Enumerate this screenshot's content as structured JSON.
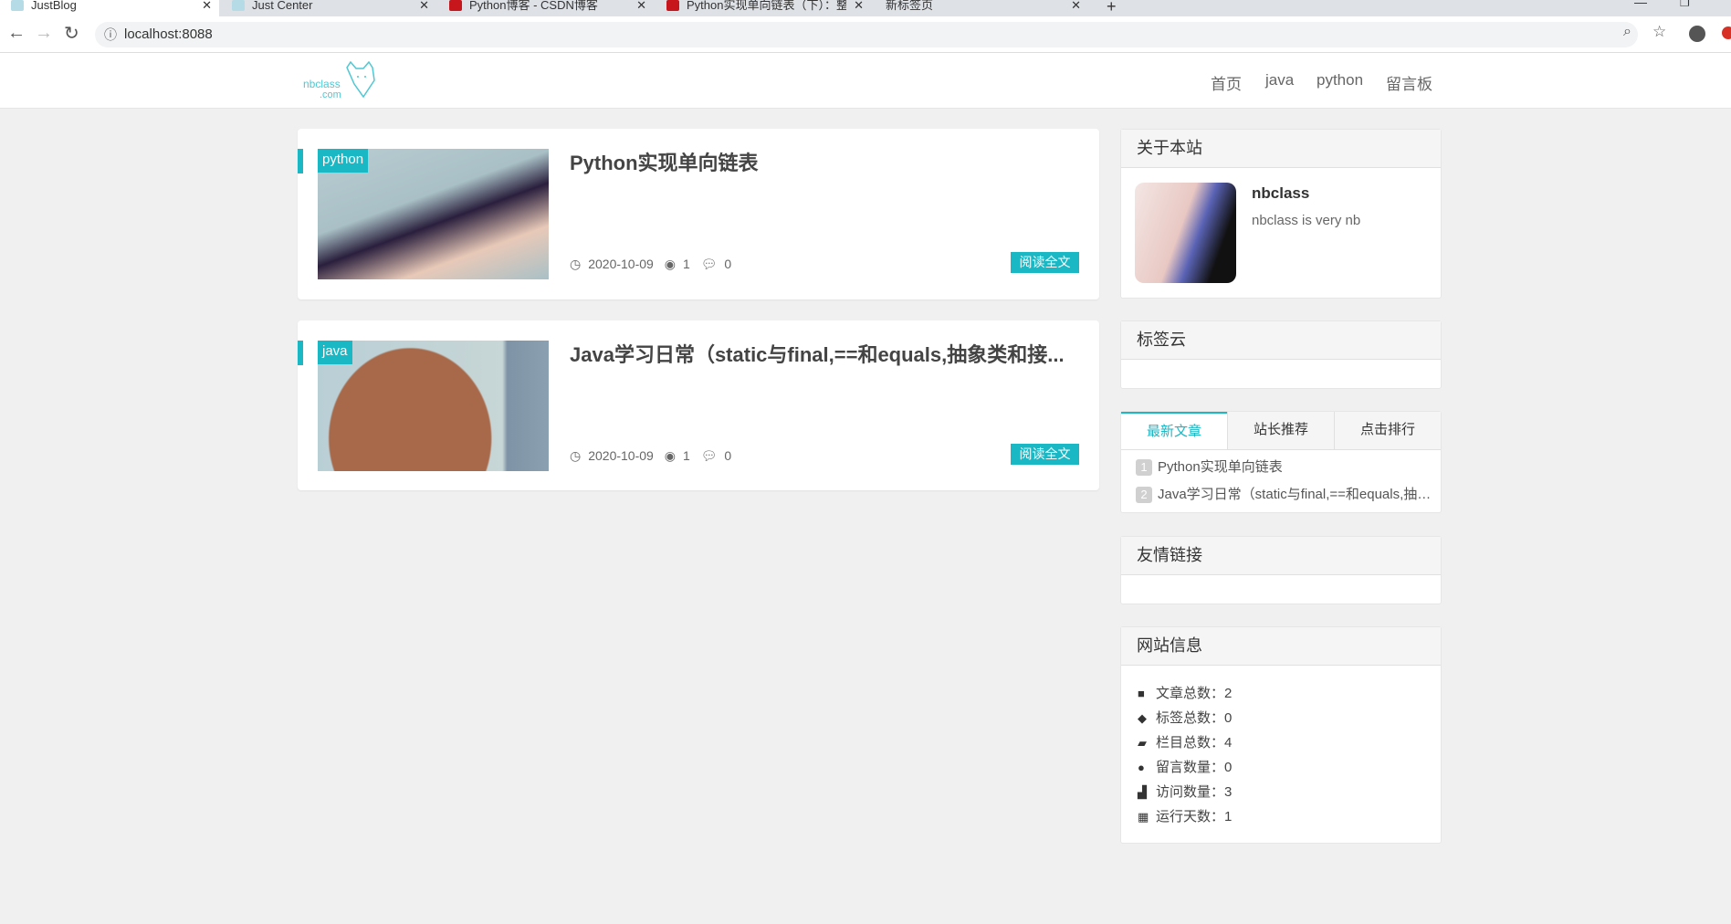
{
  "browser": {
    "tabs": [
      {
        "title": "JustBlog"
      },
      {
        "title": "Just Center"
      },
      {
        "title": "Python博客 - CSDN博客"
      },
      {
        "title": "Python实现单向链表（下）：整"
      },
      {
        "title": "新标签页"
      }
    ],
    "url": "localhost:8088"
  },
  "header": {
    "logo_text": "nbclass.com",
    "nav": [
      "首页",
      "java",
      "python",
      "留言板"
    ]
  },
  "posts": [
    {
      "category": "python",
      "title": "Python实现单向链表",
      "date": "2020-10-09",
      "views": "1",
      "comments": "0",
      "read_more": "阅读全文"
    },
    {
      "category": "java",
      "title": "Java学习日常（static与final,==和equals,抽象类和接...",
      "date": "2020-10-09",
      "views": "1",
      "comments": "0",
      "read_more": "阅读全文"
    }
  ],
  "sidebar": {
    "about": {
      "title": "关于本站",
      "name": "nbclass",
      "desc": "nbclass is very nb"
    },
    "tag_cloud": {
      "title": "标签云"
    },
    "tabs": {
      "labels": [
        "最新文章",
        "站长推荐",
        "点击排行"
      ],
      "items": [
        {
          "n": "1",
          "title": "Python实现单向链表"
        },
        {
          "n": "2",
          "title": "Java学习日常（static与final,==和equals,抽象类和接口"
        }
      ]
    },
    "links": {
      "title": "友情链接"
    },
    "site_info": {
      "title": "网站信息",
      "items": [
        {
          "label": "文章总数：",
          "value": "2"
        },
        {
          "label": "标签总数：",
          "value": "0"
        },
        {
          "label": "栏目总数：",
          "value": "4"
        },
        {
          "label": "留言数量：",
          "value": "0"
        },
        {
          "label": "访问数量：",
          "value": "3"
        },
        {
          "label": "运行天数：",
          "value": "1"
        }
      ]
    }
  },
  "colors": {
    "accent": "#1ab7c4",
    "background": "#f0f0f0"
  }
}
